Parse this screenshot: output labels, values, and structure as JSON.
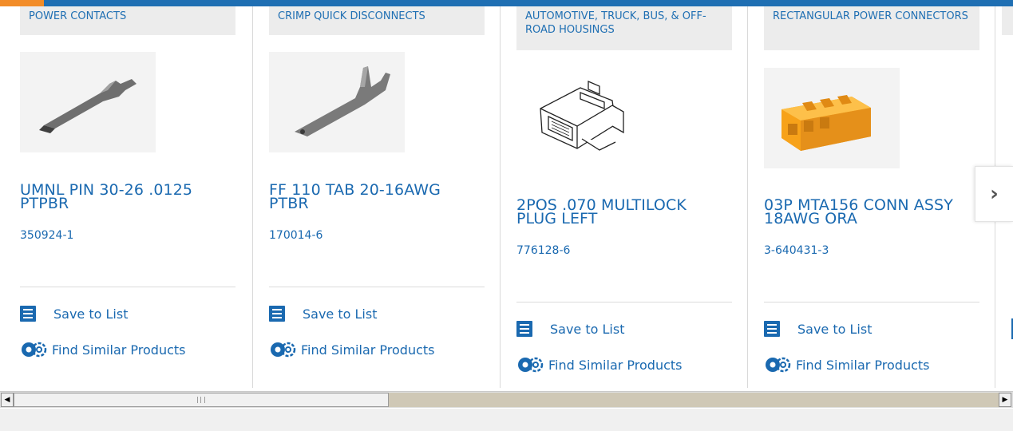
{
  "colors": {
    "brand_blue": "#1a69b0",
    "top_bar": "#1f6fb3",
    "accent_orange": "#f28c28",
    "category_bg": "#ececec"
  },
  "cards": [
    {
      "category": "POWER CONTACTS",
      "title": "UMNL PIN 30-26 .0125 PTPBR",
      "part_number": "350924-1",
      "save_label": "Save to List",
      "similar_label": "Find Similar Products"
    },
    {
      "category": "CRIMP QUICK DISCONNECTS",
      "title": "FF 110 TAB 20-16AWG PTBR",
      "part_number": "170014-6",
      "save_label": "Save to List",
      "similar_label": "Find Similar Products"
    },
    {
      "category": "AUTOMOTIVE, TRUCK, BUS, & OFF-ROAD HOUSINGS",
      "title": "2POS .070 MULTILOCK PLUG LEFT",
      "part_number": "776128-6",
      "save_label": "Save to List",
      "similar_label": "Find Similar Products"
    },
    {
      "category": "RECTANGULAR POWER CONNECTORS",
      "title": "03P MTA156 CONN ASSY 18AWG ORA",
      "part_number": "3-640431-3",
      "save_label": "Save to List",
      "similar_label": "Find Similar Products"
    }
  ],
  "icons": {
    "next": "chevron-right-icon",
    "save": "list-check-icon",
    "similar": "gears-icon"
  },
  "next_glyph": "›"
}
